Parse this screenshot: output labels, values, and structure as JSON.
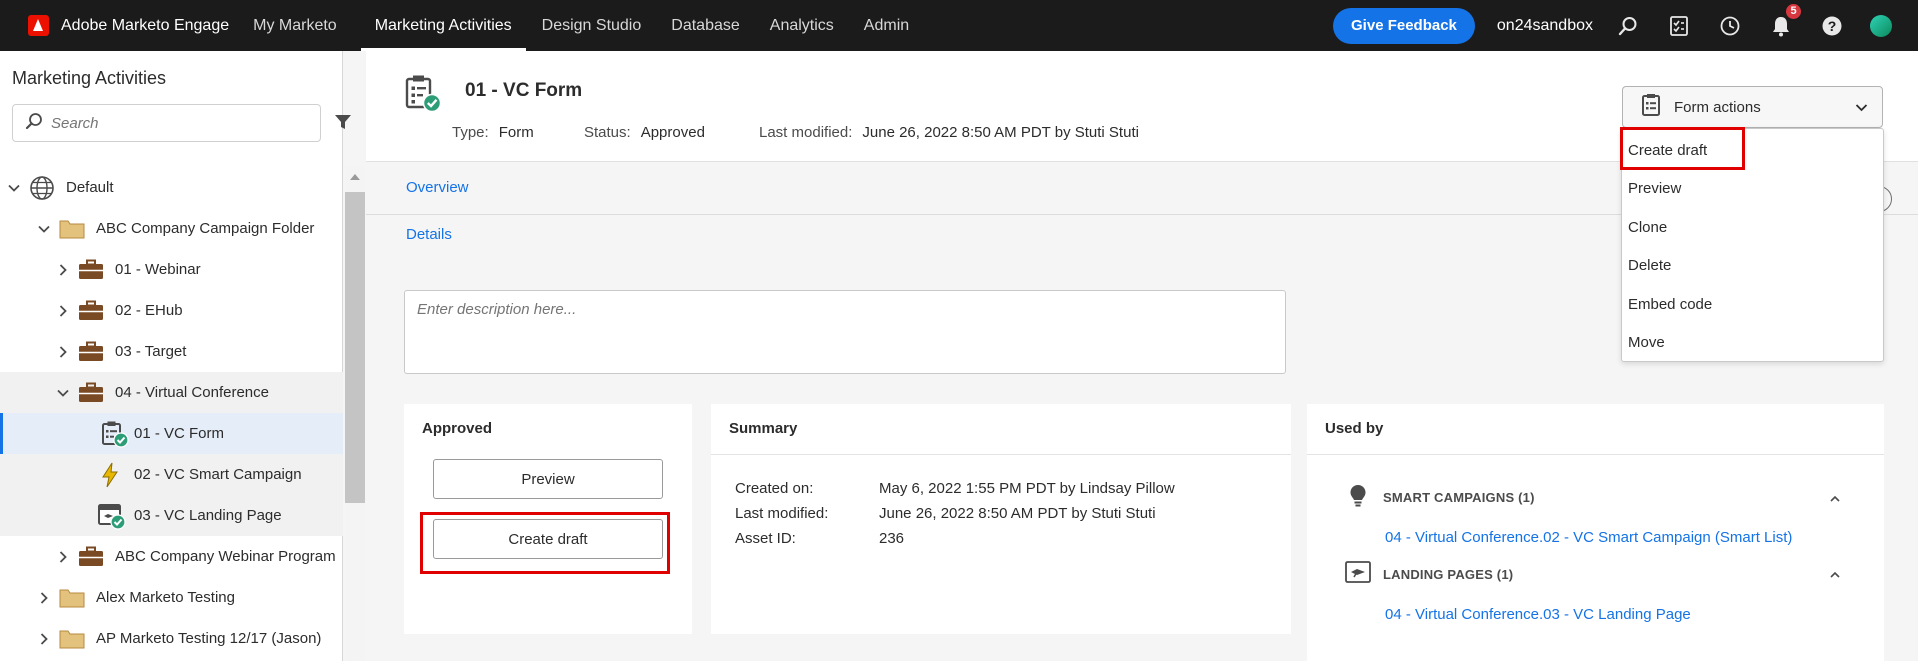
{
  "topnav": {
    "brand": "Adobe Marketo Engage",
    "items": [
      "My Marketo",
      "Marketing Activities",
      "Design Studio",
      "Database",
      "Analytics",
      "Admin"
    ],
    "active_item": "Marketing Activities",
    "feedback_label": "Give Feedback",
    "instance": "on24sandbox",
    "notification_count": "5"
  },
  "sidebar": {
    "title": "Marketing Activities",
    "search_placeholder": "Search",
    "tree": [
      {
        "label": "Default",
        "icon": "globe-icon",
        "expanded": true
      },
      {
        "label": "ABC Company Campaign Folder",
        "icon": "folder-icon",
        "expanded": true
      },
      {
        "label": "01 - Webinar",
        "icon": "program-icon",
        "expanded": false
      },
      {
        "label": "02 - EHub",
        "icon": "program-icon",
        "expanded": false
      },
      {
        "label": "03 - Target",
        "icon": "program-icon",
        "expanded": false
      },
      {
        "label": "04 - Virtual Conference",
        "icon": "program-icon",
        "expanded": true
      },
      {
        "label": "01 - VC Form",
        "icon": "form-approved-icon",
        "selected": true
      },
      {
        "label": "02 - VC Smart Campaign",
        "icon": "smart-campaign-icon"
      },
      {
        "label": "03 - VC Landing Page",
        "icon": "landing-page-approved-icon"
      },
      {
        "label": "ABC Company Webinar Program",
        "icon": "program-icon",
        "expanded": false
      },
      {
        "label": "Alex Marketo Testing",
        "icon": "folder-icon",
        "expanded": false
      },
      {
        "label": "AP Marketo Testing 12/17 (Jason)",
        "icon": "folder-icon",
        "expanded": false
      }
    ]
  },
  "asset": {
    "title": "01 - VC Form",
    "type_label": "Type:",
    "type_value": "Form",
    "status_label": "Status:",
    "status_value": "Approved",
    "modified_label": "Last modified:",
    "modified_value": "June 26, 2022 8:50 AM PDT by Stuti Stuti"
  },
  "actions": {
    "button_label": "Form actions",
    "menu": [
      "Create draft",
      "Preview",
      "Clone",
      "Delete",
      "Embed code",
      "Move"
    ]
  },
  "tabs": {
    "overview": "Overview",
    "details": "Details"
  },
  "description": {
    "placeholder": "Enter description here..."
  },
  "approved_card": {
    "title": "Approved",
    "preview_label": "Preview",
    "create_draft_label": "Create draft"
  },
  "summary_card": {
    "title": "Summary",
    "rows": [
      {
        "label": "Created on:",
        "value": "May 6, 2022 1:55 PM PDT by Lindsay Pillow"
      },
      {
        "label": "Last modified:",
        "value": "June 26, 2022 8:50 AM PDT by Stuti Stuti"
      },
      {
        "label": "Asset ID:",
        "value": "236"
      }
    ]
  },
  "used_by_card": {
    "title": "Used by",
    "groups": [
      {
        "heading": "SMART CAMPAIGNS (1)",
        "link": "04 - Virtual Conference.02 - VC Smart Campaign (Smart List)"
      },
      {
        "heading": "LANDING PAGES (1)",
        "link": "04 - Virtual Conference.03 - VC Landing Page"
      }
    ]
  },
  "colors": {
    "nav_bg": "#1b1b1b",
    "accent": "#1473e6",
    "highlight_box": "#e00000",
    "approved_check": "#2d9d78",
    "program_icon": "#7a4a25",
    "folder_icon": "#e3c27e"
  }
}
